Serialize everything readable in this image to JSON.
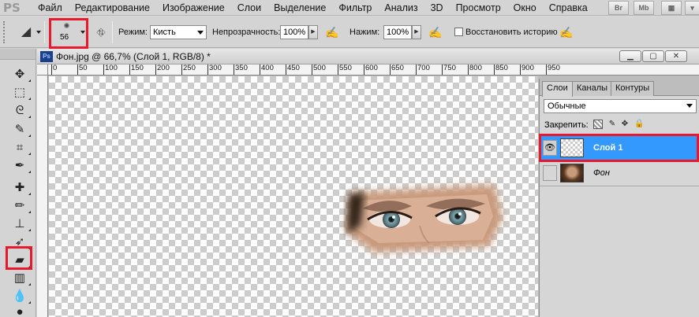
{
  "app": {
    "logo": "PS"
  },
  "menu": [
    "Файл",
    "Редактирование",
    "Изображение",
    "Слои",
    "Выделение",
    "Фильтр",
    "Анализ",
    "3D",
    "Просмотр",
    "Окно",
    "Справка"
  ],
  "top_buttons": {
    "bridge": "Br",
    "minibridge": "Mb"
  },
  "options": {
    "brush_size": "56",
    "mode_label": "Режим:",
    "mode_value": "Кисть",
    "opacity_label": "Непрозрачность:",
    "opacity_value": "100%",
    "flow_label": "Нажим:",
    "flow_value": "100%",
    "restore_history_label": "Восстановить историю"
  },
  "document": {
    "title": "Фон.jpg @ 66,7% (Слой 1, RGB/8) *",
    "tab_icon": "Ps",
    "ruler_ticks": [
      "0",
      "50",
      "100",
      "150",
      "200",
      "250",
      "300",
      "350",
      "400",
      "450",
      "500",
      "550",
      "600",
      "650",
      "700",
      "750",
      "800",
      "850",
      "900",
      "950"
    ]
  },
  "tools": [
    {
      "name": "move-tool-icon",
      "glyph": "✥"
    },
    {
      "name": "marquee-tool-icon",
      "glyph": "⬚"
    },
    {
      "name": "lasso-tool-icon",
      "glyph": "ᘓ"
    },
    {
      "name": "quick-select-tool-icon",
      "glyph": "✎"
    },
    {
      "name": "crop-tool-icon",
      "glyph": "⌗"
    },
    {
      "name": "eyedropper-tool-icon",
      "glyph": "✒"
    },
    {
      "name": "healing-brush-tool-icon",
      "glyph": "✚"
    },
    {
      "name": "brush-tool-icon",
      "glyph": "✏"
    },
    {
      "name": "clone-stamp-tool-icon",
      "glyph": "⊥"
    },
    {
      "name": "history-brush-tool-icon",
      "glyph": "➶"
    },
    {
      "name": "eraser-tool-icon",
      "glyph": "▰"
    },
    {
      "name": "gradient-tool-icon",
      "glyph": "▥"
    },
    {
      "name": "blur-tool-icon",
      "glyph": "💧"
    },
    {
      "name": "dodge-tool-icon",
      "glyph": "●"
    }
  ],
  "layers_panel": {
    "tabs": [
      "Слои",
      "Каналы",
      "Контуры"
    ],
    "blend_mode": "Обычные",
    "lock_label": "Закрепить:",
    "layers": [
      {
        "name": "Слой 1",
        "selected": true,
        "visible": true
      },
      {
        "name": "Фон",
        "selected": false,
        "visible": false
      }
    ]
  },
  "colors": {
    "highlight": "#e8192c",
    "selected_layer": "#3399ff",
    "ps_blue": "#1c3f8c"
  }
}
